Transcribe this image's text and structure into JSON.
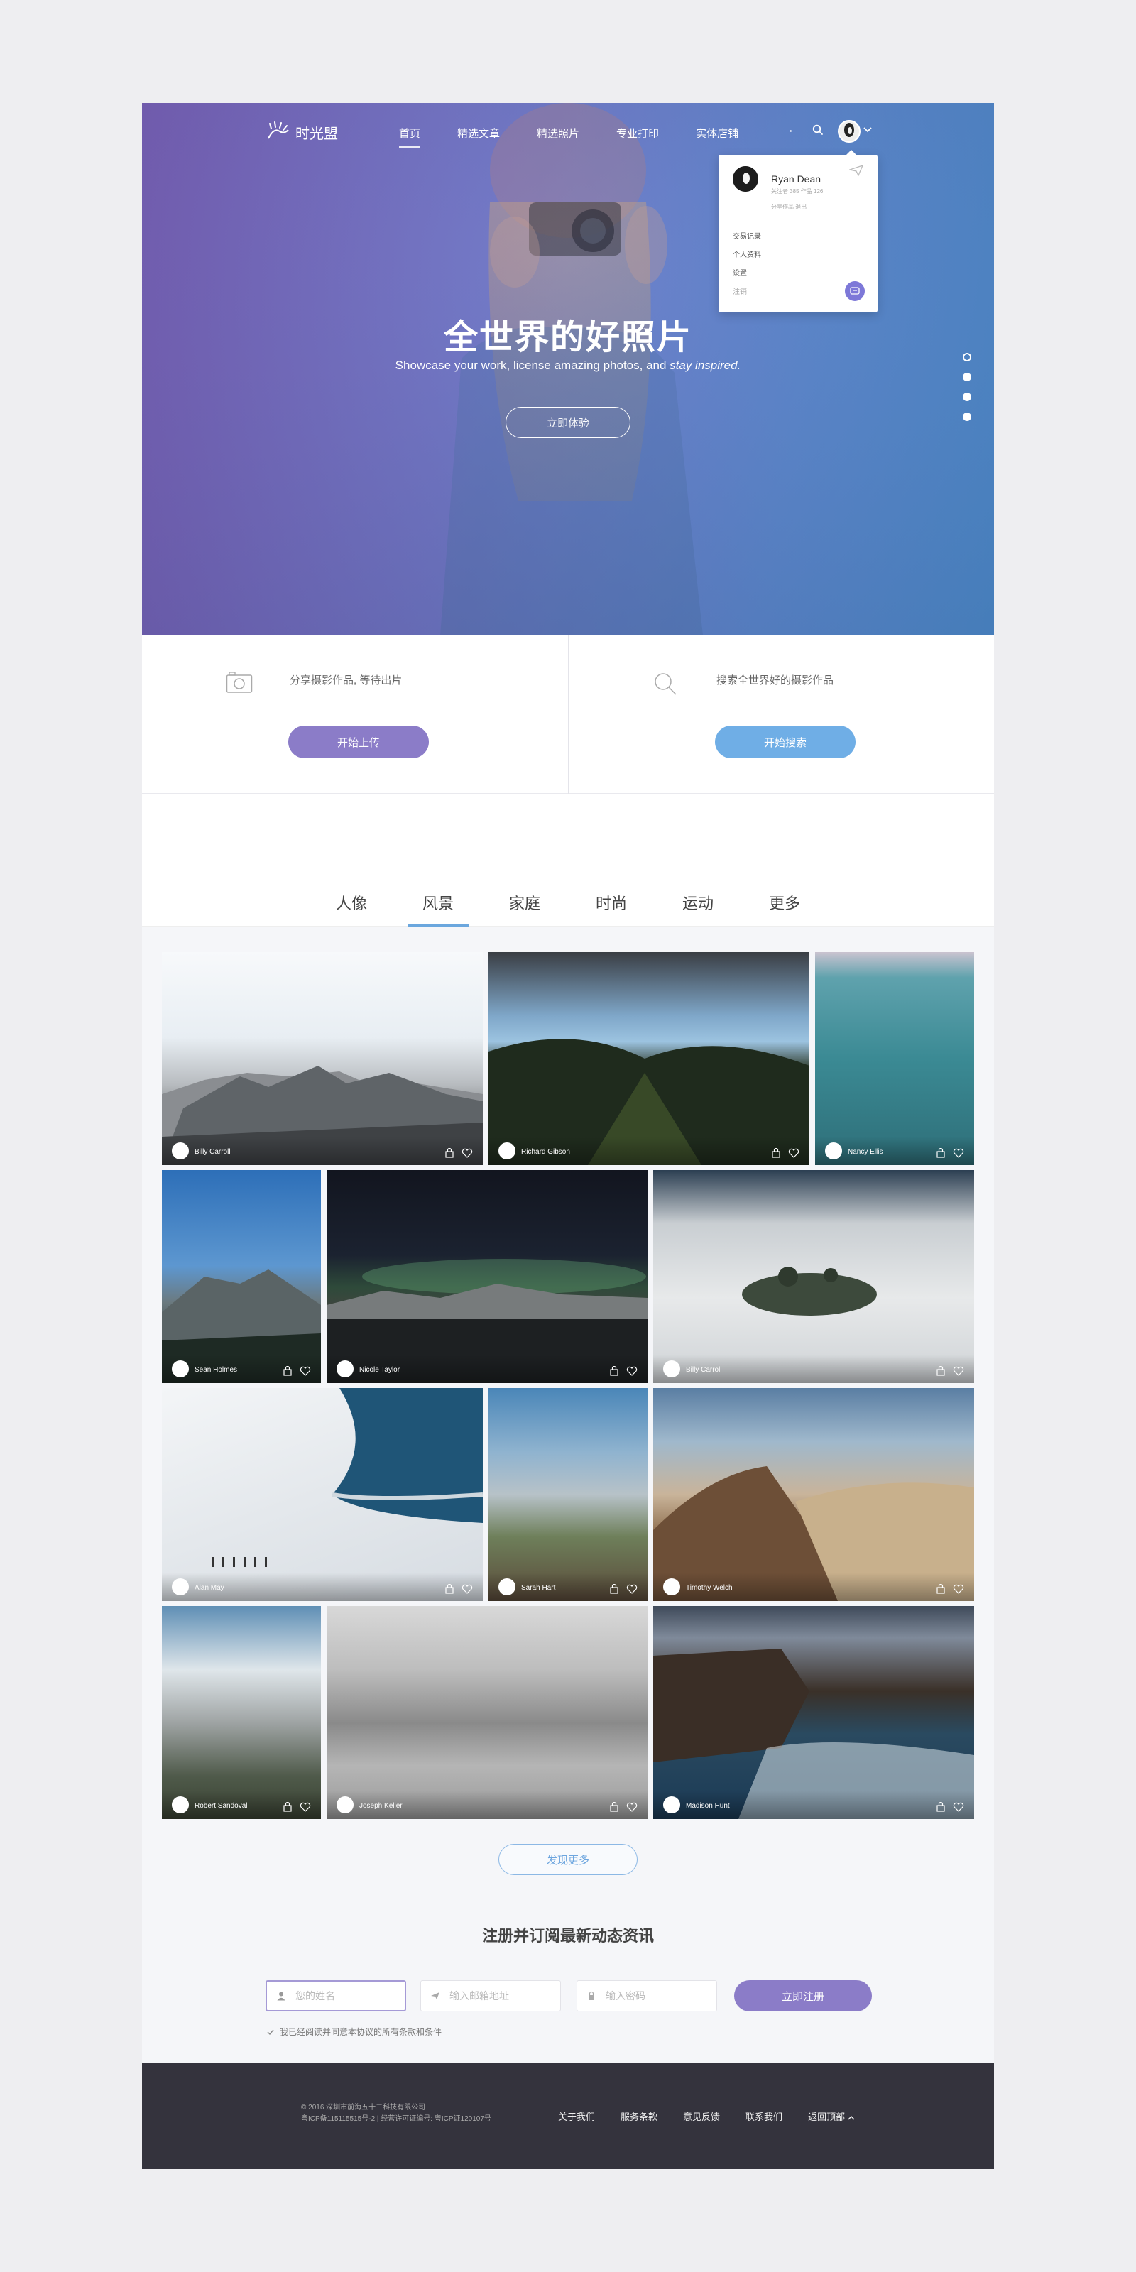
{
  "brand": {
    "name": "时光盟"
  },
  "nav": {
    "items": [
      {
        "label": "首页"
      },
      {
        "label": "精选文章"
      },
      {
        "label": "精选照片"
      },
      {
        "label": "专业打印"
      },
      {
        "label": "实体店铺"
      }
    ],
    "active_index": 0
  },
  "user_menu": {
    "name": "Ryan Dean",
    "meta": "关注者 385  作品 126",
    "sub": "分享作品  退出",
    "items": [
      "交易记录",
      "个人资料",
      "设置",
      "注销"
    ]
  },
  "hero": {
    "title": "全世界的好照片",
    "subtitle_plain": "Showcase your work, license amazing photos, and ",
    "subtitle_italic": "stay inspired.",
    "button": "立即体验",
    "slide_count": 4,
    "active_slide": 0
  },
  "actions": {
    "upload": {
      "text": "分享摄影作品, 等待出片",
      "button": "开始上传"
    },
    "search": {
      "text": "搜索全世界好的摄影作品",
      "button": "开始搜索"
    }
  },
  "tabs": [
    "人像",
    "风景",
    "家庭",
    "时尚",
    "运动",
    "更多"
  ],
  "active_tab": 1,
  "photos": [
    {
      "author": "Billy Carroll"
    },
    {
      "author": "Richard Gibson"
    },
    {
      "author": "Nancy Ellis"
    },
    {
      "author": "Sean Holmes"
    },
    {
      "author": "Nicole Taylor"
    },
    {
      "author": "Billy Carroll"
    },
    {
      "author": "Alan May"
    },
    {
      "author": "Sarah Hart"
    },
    {
      "author": "Timothy Welch"
    },
    {
      "author": "Robert Sandoval"
    },
    {
      "author": "Joseph Keller"
    },
    {
      "author": "Madison Hunt"
    }
  ],
  "more_button": "发现更多",
  "subscribe": {
    "title": "注册并订阅最新动态资讯",
    "name_placeholder": "您的姓名",
    "email_placeholder": "输入邮箱地址",
    "password_placeholder": "输入密码",
    "button": "立即注册",
    "agree": "我已经阅读并同意本协议的所有条款和条件"
  },
  "footer": {
    "copyright": "© 2016 深圳市前海五十二科技有限公司",
    "icp": "粤ICP备115115515号-2 | 经营许可证编号: 粤ICP证120107号",
    "links": [
      "关于我们",
      "服务条款",
      "意见反馈",
      "联系我们",
      "返回顶部"
    ]
  },
  "colors": {
    "accent_purple": "#8b7cc8",
    "accent_blue": "#6faee6",
    "footer_bg": "#34333d"
  }
}
